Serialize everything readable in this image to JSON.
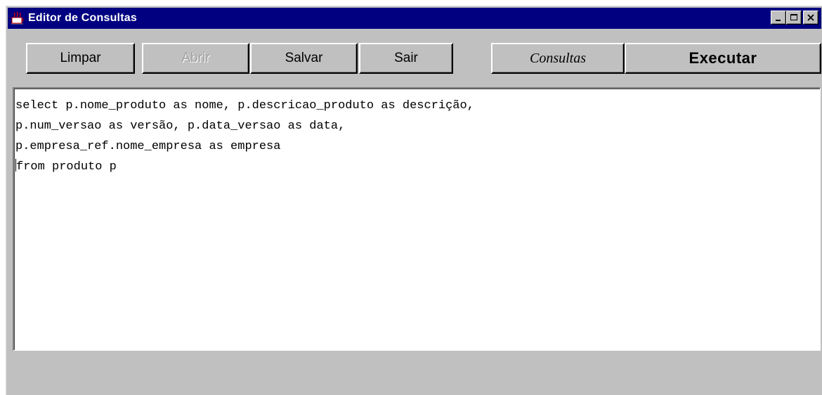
{
  "window": {
    "title": "Editor de Consultas",
    "controls": {
      "minimize": "minimize-icon",
      "maximize": "maximize-icon",
      "close": "close-icon"
    }
  },
  "toolbar": {
    "limpar_label": "Limpar",
    "abrir_label": "Abrir",
    "abrir_enabled": false,
    "salvar_label": "Salvar",
    "sair_label": "Sair",
    "consultas_label": "Consultas",
    "executar_label": "Executar"
  },
  "editor": {
    "lines": [
      "select p.nome_produto as nome, p.descricao_produto as descrição,",
      "p.num_versao as versão, p.data_versao as data,",
      "p.empresa_ref.nome_empresa as empresa",
      "from produto p"
    ]
  },
  "colors": {
    "titlebar": "#000080",
    "face": "#c0c0c0",
    "editor_bg": "#ffffff"
  }
}
